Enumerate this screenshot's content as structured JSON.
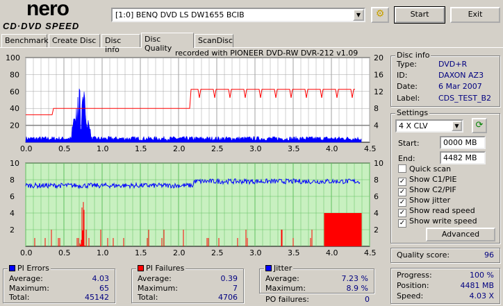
{
  "app": {
    "logo_top": "nero",
    "logo_bottom": "CD·DVD SPEED"
  },
  "toolbar": {
    "drive": "[1:0]  BENQ DVD LS DW1655 BCIB",
    "start": "Start",
    "exit": "Exit"
  },
  "tabs": [
    {
      "label": "Benchmark"
    },
    {
      "label": "Create Disc"
    },
    {
      "label": "Disc Info"
    },
    {
      "label": "Disc Quality"
    },
    {
      "label": "ScanDisc"
    }
  ],
  "chart_data": [
    {
      "type": "bar",
      "title": "recorded with PIONEER DVD-RW  DVR-212  v1.09",
      "series": "PI Errors",
      "xlim": [
        0,
        4.5
      ],
      "ylim": [
        0,
        100
      ],
      "y2lim": [
        0,
        20
      ],
      "xticks": [
        "0.0",
        "0.5",
        "1.0",
        "1.5",
        "2.0",
        "2.5",
        "3.0",
        "3.5",
        "4.0",
        "4.5"
      ],
      "yticks": [
        "100",
        "80",
        "60",
        "40",
        "20"
      ],
      "y2ticks": [
        "20",
        "16",
        "12",
        "8",
        "4"
      ],
      "notes": "PI errors mostly <10, peak 65 near 0.7 GB; read speed ~6-8X until 2.15 GB then ~12X"
    },
    {
      "type": "bar",
      "series": "PI Failures / Jitter",
      "xlim": [
        0,
        4.5
      ],
      "ylim": [
        0,
        10
      ],
      "y2lim": [
        0,
        10
      ],
      "xticks": [
        "0.0",
        "0.5",
        "1.0",
        "1.5",
        "2.0",
        "2.5",
        "3.0",
        "3.5",
        "4.0",
        "4.5"
      ],
      "yticks": [
        "10",
        "8",
        "6",
        "4",
        "2"
      ],
      "y2ticks": [
        "10",
        "8",
        "6",
        "4",
        "2"
      ],
      "notes": "jitter ~7.2-8.2%; PI failures up to 7, dense 4 from 3.9 GB"
    }
  ],
  "disc_info": {
    "title": "Disc info",
    "type_label": "Type:",
    "type": "DVD+R",
    "id_label": "ID:",
    "id": "DAXON AZ3",
    "date_label": "Date:",
    "date": "6 Mar 2007",
    "label_label": "Label:",
    "label": "CDS_TEST_B2"
  },
  "settings": {
    "title": "Settings",
    "speed": "4 X CLV",
    "start_label": "Start:",
    "start": "0000 MB",
    "end_label": "End:",
    "end": "4482 MB",
    "options": [
      {
        "label": "Quick scan",
        "checked": false
      },
      {
        "label": "Show C1/PIE",
        "checked": true
      },
      {
        "label": "Show C2/PIF",
        "checked": true
      },
      {
        "label": "Show jitter",
        "checked": true
      },
      {
        "label": "Show read speed",
        "checked": true
      },
      {
        "label": "Show write speed",
        "checked": true
      }
    ],
    "advanced": "Advanced"
  },
  "quality": {
    "label": "Quality score:",
    "value": "96"
  },
  "progress": {
    "progress_label": "Progress:",
    "progress": "100 %",
    "position_label": "Position:",
    "position": "4481 MB",
    "speed_label": "Speed:",
    "speed": "4.03 X"
  },
  "pi_errors": {
    "title": "PI Errors",
    "color": "#0000ff",
    "avg_label": "Average:",
    "avg": "4.03",
    "max_label": "Maximum:",
    "max": "65",
    "total_label": "Total:",
    "total": "45142"
  },
  "pi_failures": {
    "title": "PI Failures",
    "color": "#ff0000",
    "avg_label": "Average:",
    "avg": "0.39",
    "max_label": "Maximum:",
    "max": "7",
    "total_label": "Total:",
    "total": "4706"
  },
  "jitter": {
    "title": "Jitter",
    "color": "#0000ff",
    "avg_label": "Average:",
    "avg": "7.23 %",
    "max_label": "Maximum:",
    "max": "8.9 %",
    "po_label": "PO failures:",
    "po": "0"
  }
}
